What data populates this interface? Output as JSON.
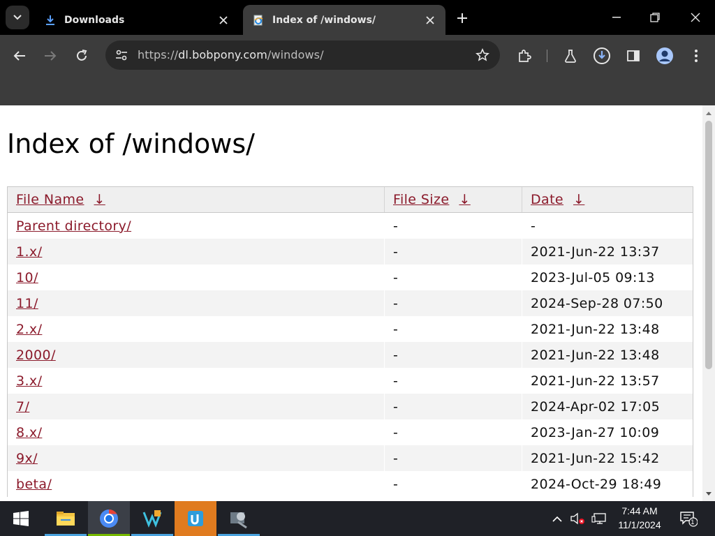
{
  "browser": {
    "tabs": [
      {
        "title": "Downloads",
        "icon": "download-icon",
        "active": false
      },
      {
        "title": "Index of /windows/",
        "icon": "ie-page-icon",
        "active": true
      }
    ],
    "address": {
      "scheme": "https://",
      "host": "dl.bobpony.com",
      "path": "/windows/"
    }
  },
  "page": {
    "title": "Index of /windows/",
    "columns": [
      {
        "label": "File Name",
        "sort": "↓"
      },
      {
        "label": "File Size",
        "sort": "↓"
      },
      {
        "label": "Date",
        "sort": "↓"
      }
    ],
    "rows": [
      {
        "name": "Parent directory/",
        "size": "-",
        "date": "-"
      },
      {
        "name": "1.x/",
        "size": "-",
        "date": "2021-Jun-22 13:37"
      },
      {
        "name": "10/",
        "size": "-",
        "date": "2023-Jul-05 09:13"
      },
      {
        "name": "11/",
        "size": "-",
        "date": "2024-Sep-28 07:50"
      },
      {
        "name": "2.x/",
        "size": "-",
        "date": "2021-Jun-22 13:48"
      },
      {
        "name": "2000/",
        "size": "-",
        "date": "2021-Jun-22 13:48"
      },
      {
        "name": "3.x/",
        "size": "-",
        "date": "2021-Jun-22 13:57"
      },
      {
        "name": "7/",
        "size": "-",
        "date": "2024-Apr-02 17:05"
      },
      {
        "name": "8.x/",
        "size": "-",
        "date": "2023-Jan-27 10:09"
      },
      {
        "name": "9x/",
        "size": "-",
        "date": "2021-Jun-22 15:42"
      },
      {
        "name": "beta/",
        "size": "-",
        "date": "2024-Oct-29 18:49"
      }
    ],
    "link_color": "#8b1a2b"
  },
  "taskbar": {
    "apps": [
      "file-explorer-icon",
      "chrome-icon",
      "visual-studio-icon",
      "app-gj-icon",
      "tool-icon"
    ],
    "clock": {
      "time": "7:44 AM",
      "date": "11/1/2024"
    },
    "notification_count": "1"
  }
}
